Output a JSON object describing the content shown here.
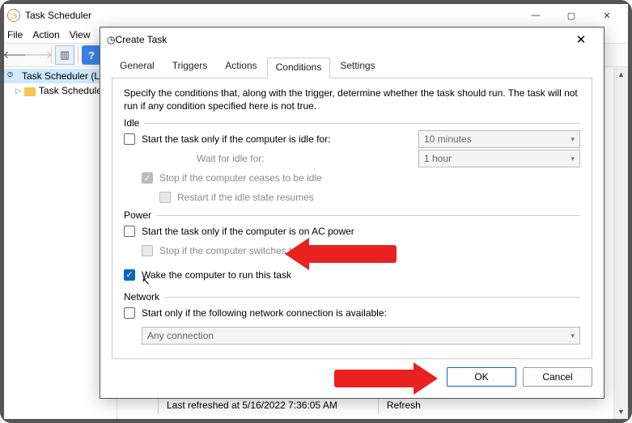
{
  "main": {
    "title": "Task Scheduler",
    "menu": {
      "file": "File",
      "action": "Action",
      "view": "View"
    },
    "tree": {
      "root": "Task Scheduler (L",
      "library": "Task Scheduler"
    },
    "status": {
      "refreshed": "Last refreshed at 5/16/2022 7:36:05 AM",
      "refresh_label": "Refresh"
    }
  },
  "dialog": {
    "title": "Create Task",
    "tabs": {
      "general": "General",
      "triggers": "Triggers",
      "actions": "Actions",
      "conditions": "Conditions",
      "settings": "Settings"
    },
    "hint": "Specify the conditions that, along with the trigger, determine whether the task should run.  The task will not run  if any condition specified here is not true.",
    "idle": {
      "group": "Idle",
      "start_label": "Start the task only if the computer is idle for:",
      "start_value": "10 minutes",
      "wait_label": "Wait for idle for:",
      "wait_value": "1 hour",
      "stop_label": "Stop if the computer ceases to be idle",
      "restart_label": "Restart if the idle state resumes"
    },
    "power": {
      "group": "Power",
      "ac_label": "Start the task only if the computer is on AC power",
      "battery_label": "Stop if the computer switches to battery power",
      "wake_label": "Wake the computer to run this task"
    },
    "network": {
      "group": "Network",
      "avail_label": "Start only if the following network connection is available:",
      "combo_value": "Any connection"
    },
    "buttons": {
      "ok": "OK",
      "cancel": "Cancel"
    }
  }
}
